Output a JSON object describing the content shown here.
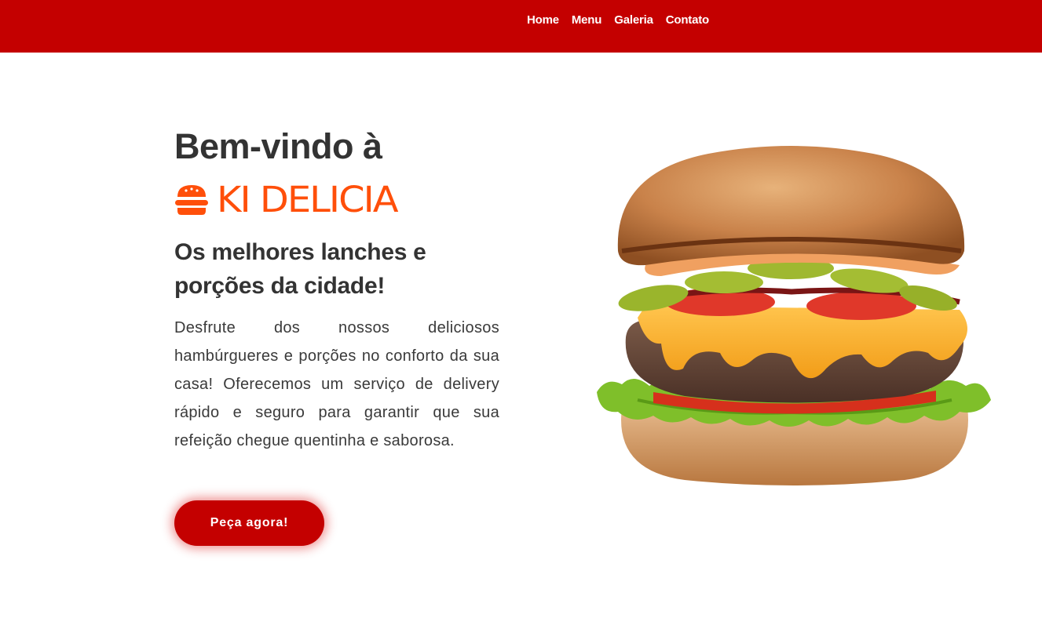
{
  "header": {
    "nav": [
      {
        "label": "Home"
      },
      {
        "label": "Menu"
      },
      {
        "label": "Galeria"
      },
      {
        "label": "Contato"
      }
    ]
  },
  "hero": {
    "welcome": "Bem-vindo à",
    "brand_name": "KI DELICIA",
    "brand_icon": "burger-icon",
    "tagline": "Os melhores lanches e porções da cidade!",
    "description": "Desfrute dos nossos deliciosos hambúrgueres e porções no conforto da sua casa! Oferecemos um serviço de delivery rápido e seguro para garantir que sua refeição chegue quentinha e saborosa.",
    "cta_label": "Peça agora!"
  },
  "colors": {
    "primary": "#c40000",
    "brand_orange": "#ff4f0a",
    "text": "#333333"
  }
}
